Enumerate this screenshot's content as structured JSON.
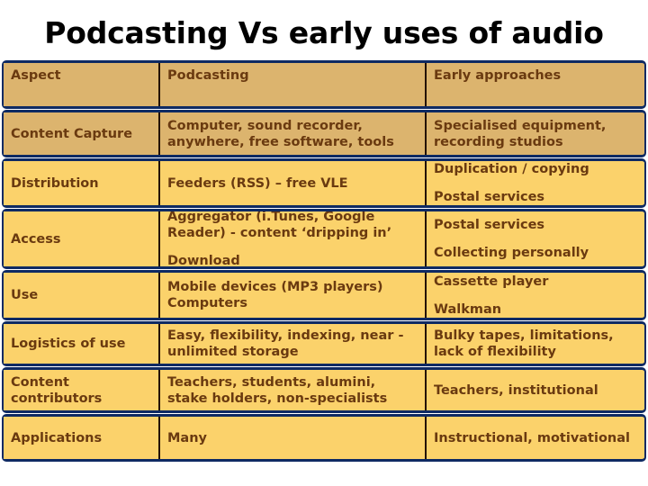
{
  "slide": {
    "title": "Podcasting Vs early uses of audio"
  },
  "table": {
    "columns": [
      "Aspect",
      "Podcasting",
      "Early approaches"
    ],
    "rows": [
      {
        "aspect": "Content Capture",
        "podcasting": [
          "Computer, sound recorder, anywhere, free software, tools"
        ],
        "early": [
          "Specialised equipment, recording studios"
        ]
      },
      {
        "aspect": "Distribution",
        "podcasting": [
          "Feeders (RSS) – free VLE"
        ],
        "early": [
          "Duplication / copying",
          "Postal services"
        ]
      },
      {
        "aspect": "Access",
        "podcasting": [
          "Aggregator (i.Tunes, Google Reader) - content ‘dripping in’",
          "Download"
        ],
        "early": [
          "Postal services",
          "Collecting personally"
        ]
      },
      {
        "aspect": "Use",
        "podcasting": [
          "Mobile devices (MP3 players) Computers"
        ],
        "early": [
          "Cassette player",
          "Walkman"
        ]
      },
      {
        "aspect": "Logistics of use",
        "podcasting": [
          "Easy, flexibility, indexing, near -unlimited storage"
        ],
        "early": [
          "Bulky tapes, limitations, lack of flexibility"
        ]
      },
      {
        "aspect": "Content contributors",
        "podcasting": [
          "Teachers, students, alumini, stake holders, non-specialists"
        ],
        "early": [
          "Teachers, institutional"
        ]
      },
      {
        "aspect": "Applications",
        "podcasting": [
          "Many"
        ],
        "early": [
          "Instructional, motivational"
        ]
      }
    ]
  },
  "colors": {
    "header_fill": "#dcb46e",
    "row_fill": "#fbd26b",
    "border": "#0e2a63",
    "divider": "#231202",
    "text": "#6a3a10",
    "title_text": "#000000",
    "background": "#ffffff"
  }
}
